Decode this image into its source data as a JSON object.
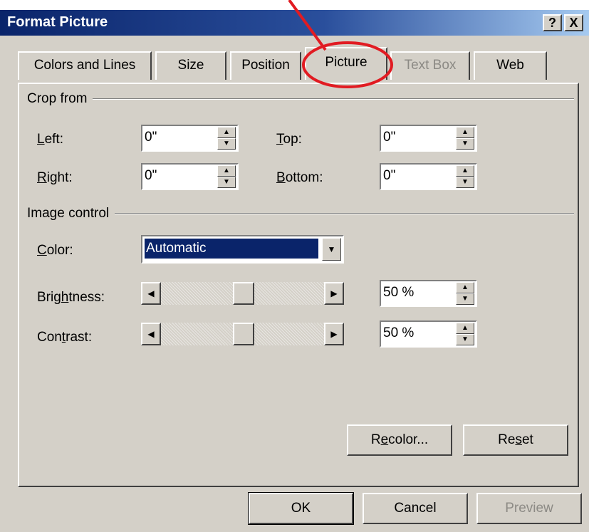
{
  "window": {
    "title": "Format Picture",
    "help_btn": "?",
    "close_btn": "X"
  },
  "tabs": [
    {
      "label": "Colors and Lines"
    },
    {
      "label": "Size"
    },
    {
      "label": "Position"
    },
    {
      "label": "Picture"
    },
    {
      "label": "Text Box"
    },
    {
      "label": "Web"
    }
  ],
  "crop": {
    "heading": "Crop from",
    "left_label": "Left:",
    "left_value": "0\"",
    "right_label": "Right:",
    "right_value": "0\"",
    "top_label": "Top:",
    "top_value": "0\"",
    "bottom_label": "Bottom:",
    "bottom_value": "0\""
  },
  "image_control": {
    "heading": "Image control",
    "color_label": "Color:",
    "color_value": "Automatic",
    "brightness_label": "Brightness:",
    "brightness_value": "50 %",
    "brightness_level": 0.5,
    "contrast_label": "Contrast:",
    "contrast_value": "50 %",
    "contrast_level": 0.5
  },
  "panel_buttons": {
    "recolor": "Recolor...",
    "reset": "Reset"
  },
  "footer": {
    "ok": "OK",
    "cancel": "Cancel",
    "preview": "Preview"
  },
  "colors": {
    "annotation": "#e11b22",
    "title_bar": "#0a246a",
    "selection": "#0a246a"
  }
}
